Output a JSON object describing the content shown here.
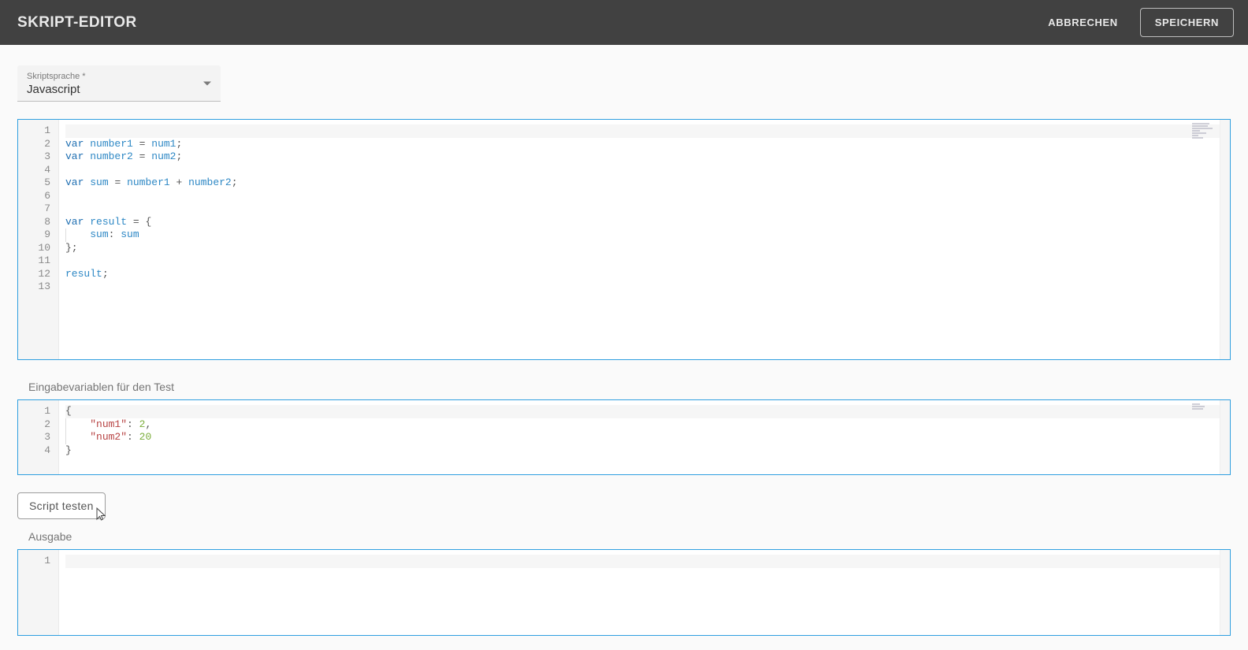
{
  "header": {
    "title": "SKRIPT-EDITOR",
    "cancel": "ABBRECHEN",
    "save": "SPEICHERN"
  },
  "languageSelect": {
    "label": "Skriptsprache *",
    "value": "Javascript"
  },
  "scriptEditor": {
    "lineCount": 13,
    "lines": [
      {
        "n": 1,
        "tokens": [],
        "active": true
      },
      {
        "n": 2,
        "tokens": [
          [
            "kw",
            "var"
          ],
          [
            "sp",
            " "
          ],
          [
            "id",
            "number1"
          ],
          [
            "sp",
            " "
          ],
          [
            "punc",
            "="
          ],
          [
            "sp",
            " "
          ],
          [
            "id",
            "num1"
          ],
          [
            "punc",
            ";"
          ]
        ]
      },
      {
        "n": 3,
        "tokens": [
          [
            "kw",
            "var"
          ],
          [
            "sp",
            " "
          ],
          [
            "id",
            "number2"
          ],
          [
            "sp",
            " "
          ],
          [
            "punc",
            "="
          ],
          [
            "sp",
            " "
          ],
          [
            "id",
            "num2"
          ],
          [
            "punc",
            ";"
          ]
        ]
      },
      {
        "n": 4,
        "tokens": []
      },
      {
        "n": 5,
        "tokens": [
          [
            "kw",
            "var"
          ],
          [
            "sp",
            " "
          ],
          [
            "id",
            "sum"
          ],
          [
            "sp",
            " "
          ],
          [
            "punc",
            "="
          ],
          [
            "sp",
            " "
          ],
          [
            "id",
            "number1"
          ],
          [
            "sp",
            " "
          ],
          [
            "punc",
            "+"
          ],
          [
            "sp",
            " "
          ],
          [
            "id",
            "number2"
          ],
          [
            "punc",
            ";"
          ]
        ]
      },
      {
        "n": 6,
        "tokens": []
      },
      {
        "n": 7,
        "tokens": []
      },
      {
        "n": 8,
        "tokens": [
          [
            "kw",
            "var"
          ],
          [
            "sp",
            " "
          ],
          [
            "id",
            "result"
          ],
          [
            "sp",
            " "
          ],
          [
            "punc",
            "="
          ],
          [
            "sp",
            " "
          ],
          [
            "punc",
            "{"
          ]
        ]
      },
      {
        "n": 9,
        "tokens": [
          [
            "indent"
          ],
          [
            "id",
            "sum"
          ],
          [
            "punc",
            ":"
          ],
          [
            "sp",
            " "
          ],
          [
            "id",
            "sum"
          ]
        ]
      },
      {
        "n": 10,
        "tokens": [
          [
            "punc",
            "};"
          ]
        ]
      },
      {
        "n": 11,
        "tokens": []
      },
      {
        "n": 12,
        "tokens": [
          [
            "id",
            "result"
          ],
          [
            "punc",
            ";"
          ]
        ]
      },
      {
        "n": 13,
        "tokens": []
      }
    ]
  },
  "inputSection": {
    "label": "Eingabevariablen für den Test",
    "lines": [
      {
        "n": 1,
        "tokens": [
          [
            "punc",
            "{"
          ]
        ],
        "active": true
      },
      {
        "n": 2,
        "tokens": [
          [
            "indent"
          ],
          [
            "str",
            "\"num1\""
          ],
          [
            "punc",
            ":"
          ],
          [
            "sp",
            " "
          ],
          [
            "num",
            "2"
          ],
          [
            "punc",
            ","
          ]
        ]
      },
      {
        "n": 3,
        "tokens": [
          [
            "indent"
          ],
          [
            "str",
            "\"num2\""
          ],
          [
            "punc",
            ":"
          ],
          [
            "sp",
            " "
          ],
          [
            "num",
            "20"
          ]
        ]
      },
      {
        "n": 4,
        "tokens": [
          [
            "punc",
            "}"
          ]
        ]
      }
    ]
  },
  "testButton": "Script testen",
  "outputSection": {
    "label": "Ausgabe",
    "lines": [
      {
        "n": 1,
        "tokens": [],
        "active": true
      }
    ]
  }
}
